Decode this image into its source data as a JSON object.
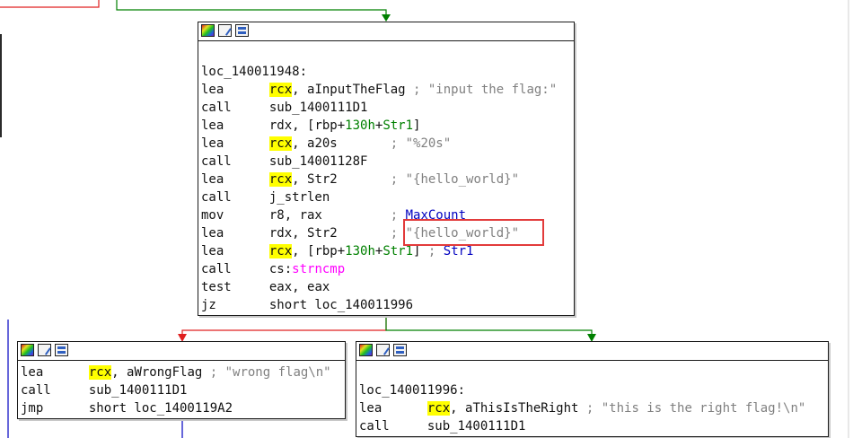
{
  "node_main": {
    "label": "loc_140011948:",
    "lines": [
      {
        "m": "lea",
        "a": "rcx",
        "hl": true,
        "rest": ", aInputTheFlag ",
        "cmt": "; \"input the flag:\""
      },
      {
        "m": "call",
        "a": "sub_1400111D1",
        "hl": false,
        "rest": "",
        "cmt": ""
      },
      {
        "m": "lea",
        "a": "rdx",
        "hl": false,
        "rest": ", [rbp+",
        "num": "130h",
        "rest2": "+",
        "sym": "Str1",
        "rest3": "]",
        "cmt": ""
      },
      {
        "m": "lea",
        "a": "rcx",
        "hl": true,
        "rest": ", a20s       ",
        "cmt": "; \"%20s\""
      },
      {
        "m": "call",
        "a": "sub_14001128F",
        "hl": false,
        "rest": "",
        "cmt": ""
      },
      {
        "m": "lea",
        "a": "rcx",
        "hl": true,
        "rest": ", Str2       ",
        "cmt": "; \"{hello_world}\""
      },
      {
        "m": "call",
        "a": "j_strlen",
        "hl": false,
        "rest": "",
        "cmt": ""
      },
      {
        "m": "mov",
        "a": "r8",
        "hl": false,
        "rest": ", rax         ",
        "cmt": "; ",
        "cmtblue": "MaxCount"
      },
      {
        "m": "lea",
        "a": "rdx",
        "hl": false,
        "rest": ", Str2       ",
        "cmt": "; \"{hello_world}\""
      },
      {
        "m": "lea",
        "a": "rcx",
        "hl": true,
        "rest": ", [rbp+",
        "num": "130h",
        "rest2": "+",
        "sym": "Str1",
        "rest3": "] ",
        "cmt": "; ",
        "cmtblue": "Str1"
      },
      {
        "m": "call",
        "a": "cs:",
        "hl": false,
        "rest": "",
        "fn": "strncmp",
        "cmt": ""
      },
      {
        "m": "test",
        "a": "eax",
        "hl": false,
        "rest": ", eax",
        "cmt": ""
      },
      {
        "m": "jz",
        "a": "short loc_140011996",
        "hl": false,
        "rest": "",
        "cmt": ""
      }
    ]
  },
  "node_wrong": {
    "lines": [
      {
        "m": "lea",
        "a": "rcx",
        "hl": true,
        "rest": ", aWrongFlag ",
        "cmt": "; \"wrong flag\\n\""
      },
      {
        "m": "call",
        "a": "sub_1400111D1",
        "hl": false,
        "rest": "",
        "cmt": ""
      },
      {
        "m": "jmp",
        "a": "short loc_1400119A2",
        "hl": false,
        "rest": "",
        "cmt": ""
      }
    ]
  },
  "node_right": {
    "label": "loc_140011996:",
    "lines": [
      {
        "m": "lea",
        "a": "rcx",
        "hl": true,
        "rest": ", aThisIsTheRight ",
        "cmt": "; \"this is the right flag!\\n\""
      },
      {
        "m": "call",
        "a": "sub_1400111D1",
        "hl": false,
        "rest": "",
        "cmt": ""
      }
    ]
  },
  "colors": {
    "edge_false": "#e02020",
    "edge_true": "#008000",
    "edge_flow": "#0000c0",
    "highlight": "#ffff00",
    "annotation_box": "#e23b3b"
  }
}
